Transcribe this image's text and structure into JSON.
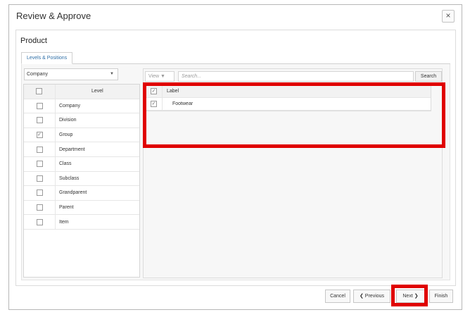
{
  "dialog": {
    "title": "Review & Approve",
    "close_glyph": "×"
  },
  "panel": {
    "title": "Product",
    "tab_label": "Levels & Positions"
  },
  "left": {
    "select_value": "Company",
    "select_caret": "▼",
    "header": "Level",
    "rows": [
      {
        "label": "Company",
        "checked": false
      },
      {
        "label": "Division",
        "checked": false
      },
      {
        "label": "Group",
        "checked": true
      },
      {
        "label": "Department",
        "checked": false
      },
      {
        "label": "Class",
        "checked": false
      },
      {
        "label": "Subclass",
        "checked": false
      },
      {
        "label": "Grandparent",
        "checked": false
      },
      {
        "label": "Parent",
        "checked": false
      },
      {
        "label": "Item",
        "checked": false
      }
    ]
  },
  "right": {
    "view_label": "View ▼",
    "search_placeholder": "Search...",
    "search_button": "Search",
    "header": "Label",
    "rows": [
      {
        "label": "Footwear",
        "checked": true
      }
    ]
  },
  "footer": {
    "cancel": "Cancel",
    "previous": "Previous",
    "previous_glyph": "❮",
    "next": "Next",
    "next_glyph": "❯",
    "finish": "Finish"
  },
  "colors": {
    "highlight": "#e00000",
    "tab_text": "#2f6fa7"
  },
  "check_glyph": "✓"
}
